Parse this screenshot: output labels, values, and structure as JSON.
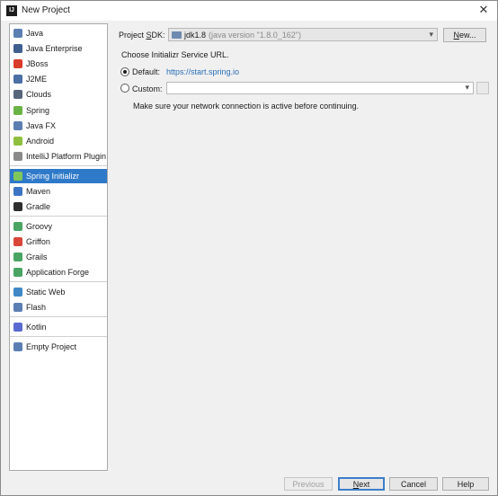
{
  "window": {
    "title": "New Project",
    "close_glyph": "✕",
    "app_icon_text": "IJ"
  },
  "sidebar": {
    "items": [
      {
        "label": "Java",
        "icon": "java-folder-icon",
        "color": "#5b7fb3"
      },
      {
        "label": "Java Enterprise",
        "icon": "java-enterprise-icon",
        "color": "#3e5f8f"
      },
      {
        "label": "JBoss",
        "icon": "jboss-icon",
        "color": "#d93b2b"
      },
      {
        "label": "J2ME",
        "icon": "j2me-icon",
        "color": "#4a6fa5"
      },
      {
        "label": "Clouds",
        "icon": "clouds-icon",
        "color": "#56657a"
      },
      {
        "label": "Spring",
        "icon": "spring-leaf-icon",
        "color": "#6ab344"
      },
      {
        "label": "Java FX",
        "icon": "javafx-folder-icon",
        "color": "#5b7fb3"
      },
      {
        "label": "Android",
        "icon": "android-icon",
        "color": "#8fbf3f"
      },
      {
        "label": "IntelliJ Platform Plugin",
        "icon": "plugin-icon",
        "color": "#8a8a8a"
      },
      {
        "label": "Spring Initializr",
        "icon": "spring-initializr-icon",
        "color": "#7fc75a"
      },
      {
        "label": "Maven",
        "icon": "maven-icon",
        "color": "#3b74c4"
      },
      {
        "label": "Gradle",
        "icon": "gradle-icon",
        "color": "#2e2e2e"
      },
      {
        "label": "Groovy",
        "icon": "groovy-icon",
        "color": "#4aa564"
      },
      {
        "label": "Griffon",
        "icon": "griffon-icon",
        "color": "#d9473b"
      },
      {
        "label": "Grails",
        "icon": "grails-icon",
        "color": "#4aa564"
      },
      {
        "label": "Application Forge",
        "icon": "application-forge-icon",
        "color": "#4aa564"
      },
      {
        "label": "Static Web",
        "icon": "static-web-icon",
        "color": "#3f88c5"
      },
      {
        "label": "Flash",
        "icon": "flash-folder-icon",
        "color": "#5b7fb3"
      },
      {
        "label": "Kotlin",
        "icon": "kotlin-icon",
        "color": "#5b6ad0"
      },
      {
        "label": "Empty Project",
        "icon": "empty-project-icon",
        "color": "#5b7fb3"
      }
    ],
    "selected_index": 9
  },
  "main": {
    "sdk_label_pre": "Project ",
    "sdk_label_key": "S",
    "sdk_label_post": "DK:",
    "sdk_name": "jdk1.8",
    "sdk_detail": "(java version \"1.8.0_162\")",
    "new_btn_key": "N",
    "new_btn_rest": "ew...",
    "choose_url_label": "Choose Initializr Service URL.",
    "default_label": "Default:",
    "default_url": "https://start.spring.io",
    "custom_label": "Custom:",
    "custom_value": "",
    "network_note": "Make sure your network connection is active before continuing."
  },
  "footer": {
    "previous_label": "Previous",
    "next_key": "N",
    "next_rest": "ext",
    "cancel_label": "Cancel",
    "help_label": "Help"
  },
  "colors": {
    "selection": "#2f79c9",
    "link": "#2a6fb5"
  }
}
